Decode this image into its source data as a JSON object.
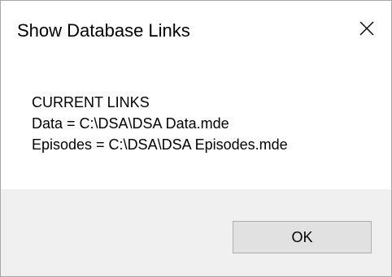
{
  "dialog": {
    "title": "Show Database Links",
    "close_icon": "close-icon",
    "message": {
      "heading": "CURRENT LINKS",
      "lines": [
        "Data = C:\\DSA\\DSA Data.mde",
        "Episodes = C:\\DSA\\DSA Episodes.mde"
      ]
    },
    "ok_label": "OK"
  }
}
